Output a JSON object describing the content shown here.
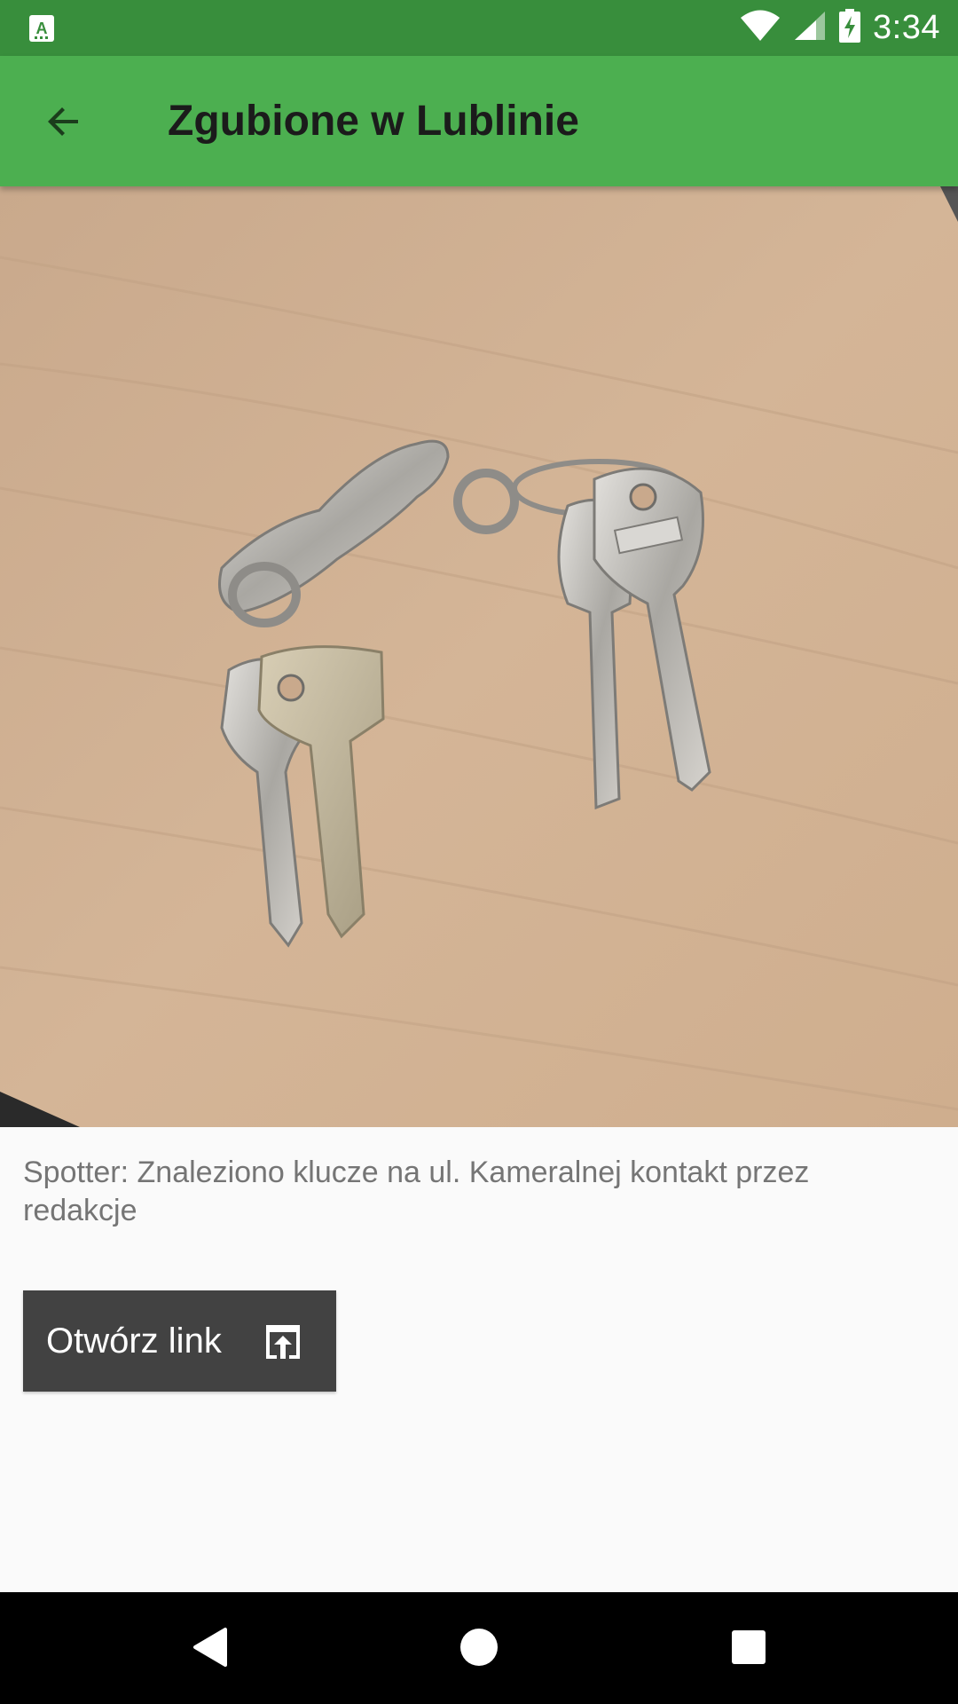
{
  "status_bar": {
    "time": "3:34",
    "icons": [
      "keyboard-a-icon",
      "wifi-icon",
      "signal-icon",
      "battery-charging-icon"
    ]
  },
  "app_bar": {
    "title": "Zgubione w Lublinie",
    "back_icon": "arrow-back-icon"
  },
  "photo": {
    "subject": "keys-photo"
  },
  "description": "Spotter: Znaleziono klucze na ul. Kameralnej kontakt przez redakcje",
  "open_link_button": {
    "label": "Otwórz link",
    "icon": "open-in-browser-icon"
  },
  "nav_bar": {
    "buttons": [
      "back-triangle-icon",
      "home-circle-icon",
      "recents-square-icon"
    ]
  },
  "colors": {
    "status_bar": "#388e3c",
    "app_bar": "#4caf50",
    "button": "#424242",
    "text_secondary": "#757575"
  }
}
